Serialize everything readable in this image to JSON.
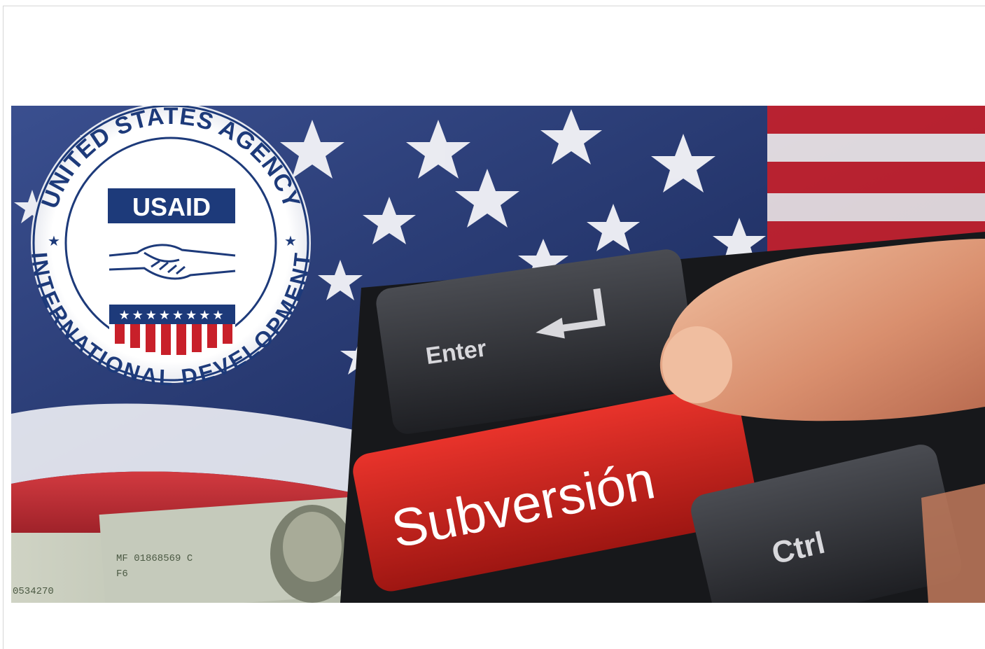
{
  "image": {
    "alt": "USAID seal over American flag with keyboard Subversión key",
    "seal": {
      "ring_top_text": "UNITED STATES AGENCY",
      "ring_bottom_text": "INTERNATIONAL DEVELOPMENT",
      "badge_text": "USAID"
    },
    "keys": {
      "enter": "Enter",
      "subversion": "Subversión",
      "ctrl": "Ctrl"
    },
    "banknote": {
      "serial": "MF 01868569 C",
      "code": "F6",
      "left_serial": "0534270"
    },
    "colors": {
      "flag_blue": "#2b3b72",
      "flag_red": "#c8202a",
      "key_red": "#d4231d",
      "key_dark": "#2d2f33",
      "seal_blue": "#1d3a7a"
    }
  }
}
